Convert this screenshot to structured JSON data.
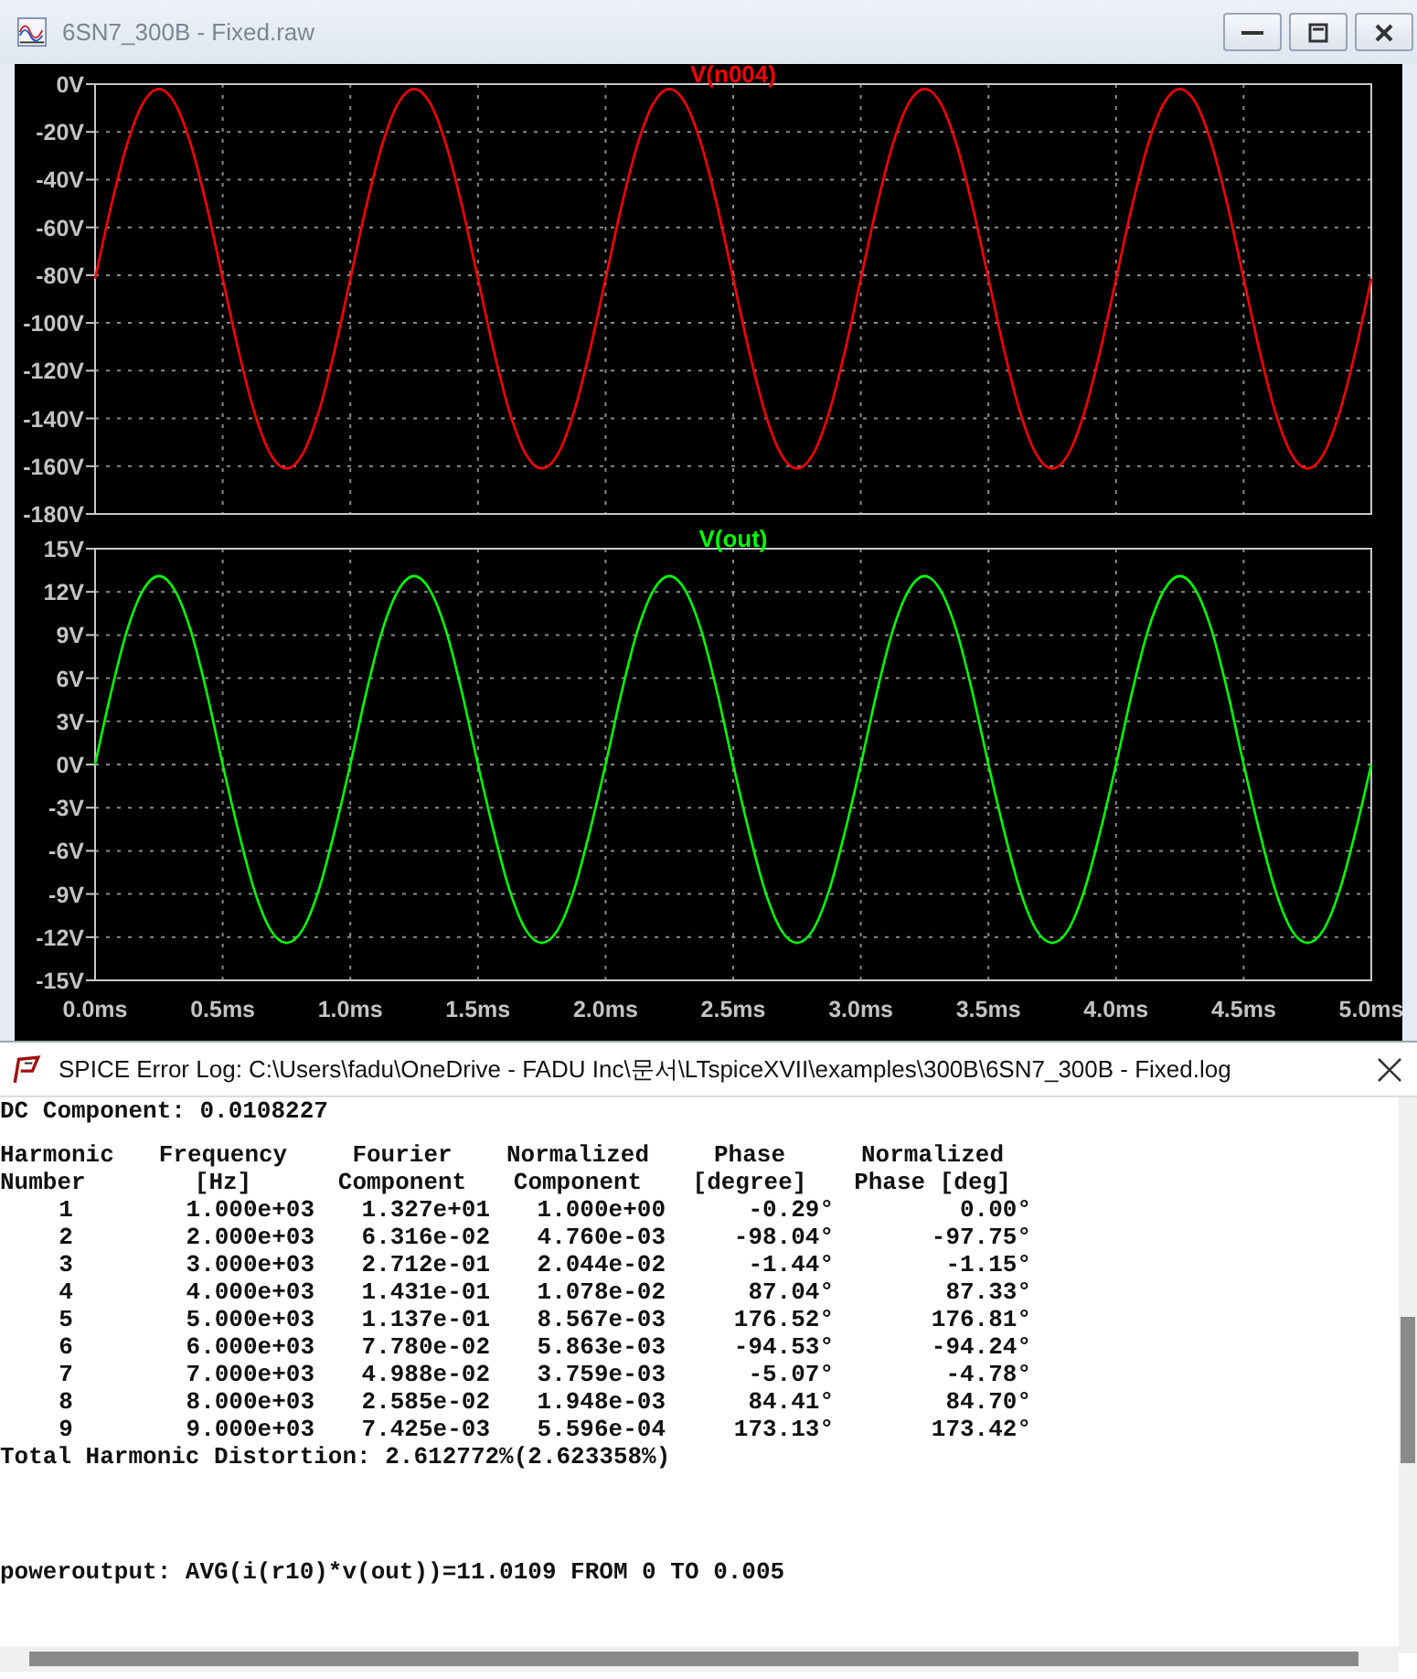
{
  "window": {
    "title": "6SN7_300B - Fixed.raw"
  },
  "plots": [
    {
      "chart_data": {
        "type": "line",
        "grid": true,
        "xlim": [
          0,
          5
        ],
        "ylim": [
          -180,
          0
        ],
        "yticks": [
          {
            "value": 0,
            "label": "0V"
          },
          {
            "value": -20,
            "label": "-20V"
          },
          {
            "value": -40,
            "label": "-40V"
          },
          {
            "value": -60,
            "label": "-60V"
          },
          {
            "value": -80,
            "label": "-80V"
          },
          {
            "value": -100,
            "label": "-100V"
          },
          {
            "value": -120,
            "label": "-120V"
          },
          {
            "value": -140,
            "label": "-140V"
          },
          {
            "value": -160,
            "label": "-160V"
          },
          {
            "value": -180,
            "label": "-180V"
          }
        ],
        "x": [
          0,
          0.0625,
          0.125,
          0.1875,
          0.25,
          0.3125,
          0.375,
          0.4375,
          0.5,
          0.5625,
          0.625,
          0.6875,
          0.75,
          0.8125,
          0.875,
          0.9375,
          1,
          1.0625,
          1.125,
          1.1875,
          1.25,
          1.3125,
          1.375,
          1.4375,
          1.5,
          1.5625,
          1.625,
          1.6875,
          1.75,
          1.8125,
          1.875,
          1.9375,
          2,
          2.0625,
          2.125,
          2.1875,
          2.25,
          2.3125,
          2.375,
          2.4375,
          2.5,
          2.5625,
          2.625,
          2.6875,
          2.75,
          2.8125,
          2.875,
          2.9375,
          3,
          3.0625,
          3.125,
          3.1875,
          3.25,
          3.3125,
          3.375,
          3.4375,
          3.5,
          3.5625,
          3.625,
          3.6875,
          3.75,
          3.8125,
          3.875,
          3.9375,
          4,
          4.0625,
          4.125,
          4.1875,
          4.25,
          4.3125,
          4.375,
          4.4375,
          4.5,
          4.5625,
          4.625,
          4.6875,
          4.75,
          4.8125,
          4.875,
          4.9375,
          5
        ],
        "series": [
          {
            "name": "V(n004)",
            "color": "#ff0000",
            "values": [
              -81.5,
              -51.1,
              -25.3,
              -8,
              -2,
              -8,
              -25.3,
              -51.1,
              -81.5,
              -111.9,
              -137.7,
              -155,
              -161,
              -155,
              -137.7,
              -111.9,
              -81.5,
              -51.1,
              -25.3,
              -8,
              -2,
              -8,
              -25.3,
              -51.1,
              -81.5,
              -111.9,
              -137.7,
              -155,
              -161,
              -155,
              -137.7,
              -111.9,
              -81.5,
              -51.1,
              -25.3,
              -8,
              -2,
              -8,
              -25.3,
              -51.1,
              -81.5,
              -111.9,
              -137.7,
              -155,
              -161,
              -155,
              -137.7,
              -111.9,
              -81.5,
              -51.1,
              -25.3,
              -8,
              -2,
              -8,
              -25.3,
              -51.1,
              -81.5,
              -111.9,
              -137.7,
              -155,
              -161,
              -155,
              -137.7,
              -111.9,
              -81.5,
              -51.1,
              -25.3,
              -8,
              -2,
              -8,
              -25.3,
              -51.1,
              -81.5,
              -111.9,
              -137.7,
              -155,
              -161,
              -155,
              -137.7,
              -111.9,
              -81.5
            ]
          }
        ]
      }
    },
    {
      "chart_data": {
        "type": "line",
        "grid": true,
        "xlim": [
          0,
          5
        ],
        "ylim": [
          -15,
          15
        ],
        "xticks": [
          {
            "value": 0,
            "label": "0.0ms"
          },
          {
            "value": 0.5,
            "label": "0.5ms"
          },
          {
            "value": 1,
            "label": "1.0ms"
          },
          {
            "value": 1.5,
            "label": "1.5ms"
          },
          {
            "value": 2,
            "label": "2.0ms"
          },
          {
            "value": 2.5,
            "label": "2.5ms"
          },
          {
            "value": 3,
            "label": "3.0ms"
          },
          {
            "value": 3.5,
            "label": "3.5ms"
          },
          {
            "value": 4,
            "label": "4.0ms"
          },
          {
            "value": 4.5,
            "label": "4.5ms"
          },
          {
            "value": 5,
            "label": "5.0ms"
          }
        ],
        "yticks": [
          {
            "value": 15,
            "label": "15V"
          },
          {
            "value": 12,
            "label": "12V"
          },
          {
            "value": 9,
            "label": "9V"
          },
          {
            "value": 6,
            "label": "6V"
          },
          {
            "value": 3,
            "label": "3V"
          },
          {
            "value": 0,
            "label": "0V"
          },
          {
            "value": -3,
            "label": "-3V"
          },
          {
            "value": -6,
            "label": "-6V"
          },
          {
            "value": -9,
            "label": "-9V"
          },
          {
            "value": -12,
            "label": "-12V"
          },
          {
            "value": -15,
            "label": "-15V"
          }
        ],
        "x": [
          0,
          0.0625,
          0.125,
          0.1875,
          0.25,
          0.3125,
          0.375,
          0.4375,
          0.5,
          0.5625,
          0.625,
          0.6875,
          0.75,
          0.8125,
          0.875,
          0.9375,
          1,
          1.0625,
          1.125,
          1.1875,
          1.25,
          1.3125,
          1.375,
          1.4375,
          1.5,
          1.5625,
          1.625,
          1.6875,
          1.75,
          1.8125,
          1.875,
          1.9375,
          2,
          2.0625,
          2.125,
          2.1875,
          2.25,
          2.3125,
          2.375,
          2.4375,
          2.5,
          2.5625,
          2.625,
          2.6875,
          2.75,
          2.8125,
          2.875,
          2.9375,
          3,
          3.0625,
          3.125,
          3.1875,
          3.25,
          3.3125,
          3.375,
          3.4375,
          3.5,
          3.5625,
          3.625,
          3.6875,
          3.75,
          3.8125,
          3.875,
          3.9375,
          4,
          4.0625,
          4.125,
          4.1875,
          4.25,
          4.3125,
          4.375,
          4.4375,
          4.5,
          4.5625,
          4.625,
          4.6875,
          4.75,
          4.8125,
          4.875,
          4.9375,
          5
        ],
        "series": [
          {
            "name": "V(out)",
            "color": "#00ff00",
            "values": [
              0,
              5,
              9.3,
              12.1,
              13.1,
              12.1,
              9.3,
              5,
              0,
              -4.7,
              -8.8,
              -11.5,
              -12.4,
              -11.5,
              -8.8,
              -4.7,
              0,
              5,
              9.3,
              12.1,
              13.1,
              12.1,
              9.3,
              5,
              0,
              -4.7,
              -8.8,
              -11.5,
              -12.4,
              -11.5,
              -8.8,
              -4.7,
              0,
              5,
              9.3,
              12.1,
              13.1,
              12.1,
              9.3,
              5,
              0,
              -4.7,
              -8.8,
              -11.5,
              -12.4,
              -11.5,
              -8.8,
              -4.7,
              0,
              5,
              9.3,
              12.1,
              13.1,
              12.1,
              9.3,
              5,
              0,
              -4.7,
              -8.8,
              -11.5,
              -12.4,
              -11.5,
              -8.8,
              -4.7,
              0,
              5,
              9.3,
              12.1,
              13.1,
              12.1,
              9.3,
              5,
              0,
              -4.7,
              -8.8,
              -11.5,
              -12.4,
              -11.5,
              -8.8,
              -4.7,
              0
            ]
          }
        ]
      }
    }
  ],
  "log": {
    "title": "SPICE Error Log: C:\\Users\\fadu\\OneDrive - FADU Inc\\문서\\LTspiceXVII\\examples\\300B\\6SN7_300B - Fixed.log",
    "dc_line": "DC Component: 0.0108227",
    "header_lines": [
      [
        "Harmonic",
        "Frequency",
        "Fourier",
        "Normalized",
        "Phase",
        "Normalized"
      ],
      [
        "Number",
        "[Hz]",
        "Component",
        "Component",
        "[degree]",
        "Phase [deg]"
      ]
    ],
    "rows": [
      [
        "1",
        "1.000e+03",
        "1.327e+01",
        "1.000e+00",
        "-0.29°",
        "0.00°"
      ],
      [
        "2",
        "2.000e+03",
        "6.316e-02",
        "4.760e-03",
        "-98.04°",
        "-97.75°"
      ],
      [
        "3",
        "3.000e+03",
        "2.712e-01",
        "2.044e-02",
        "-1.44°",
        "-1.15°"
      ],
      [
        "4",
        "4.000e+03",
        "1.431e-01",
        "1.078e-02",
        "87.04°",
        "87.33°"
      ],
      [
        "5",
        "5.000e+03",
        "1.137e-01",
        "8.567e-03",
        "176.52°",
        "176.81°"
      ],
      [
        "6",
        "6.000e+03",
        "7.780e-02",
        "5.863e-03",
        "-94.53°",
        "-94.24°"
      ],
      [
        "7",
        "7.000e+03",
        "4.988e-02",
        "3.759e-03",
        "-5.07°",
        "-4.78°"
      ],
      [
        "8",
        "8.000e+03",
        "2.585e-02",
        "1.948e-03",
        "84.41°",
        "84.70°"
      ],
      [
        "9",
        "9.000e+03",
        "7.425e-03",
        "5.596e-04",
        "173.13°",
        "173.42°"
      ]
    ],
    "thd_line": "Total Harmonic Distortion: 2.612772%(2.623358%)",
    "measure_line": "poweroutput: AVG(i(r10)*v(out))=11.0109 FROM 0 TO 0.005"
  }
}
